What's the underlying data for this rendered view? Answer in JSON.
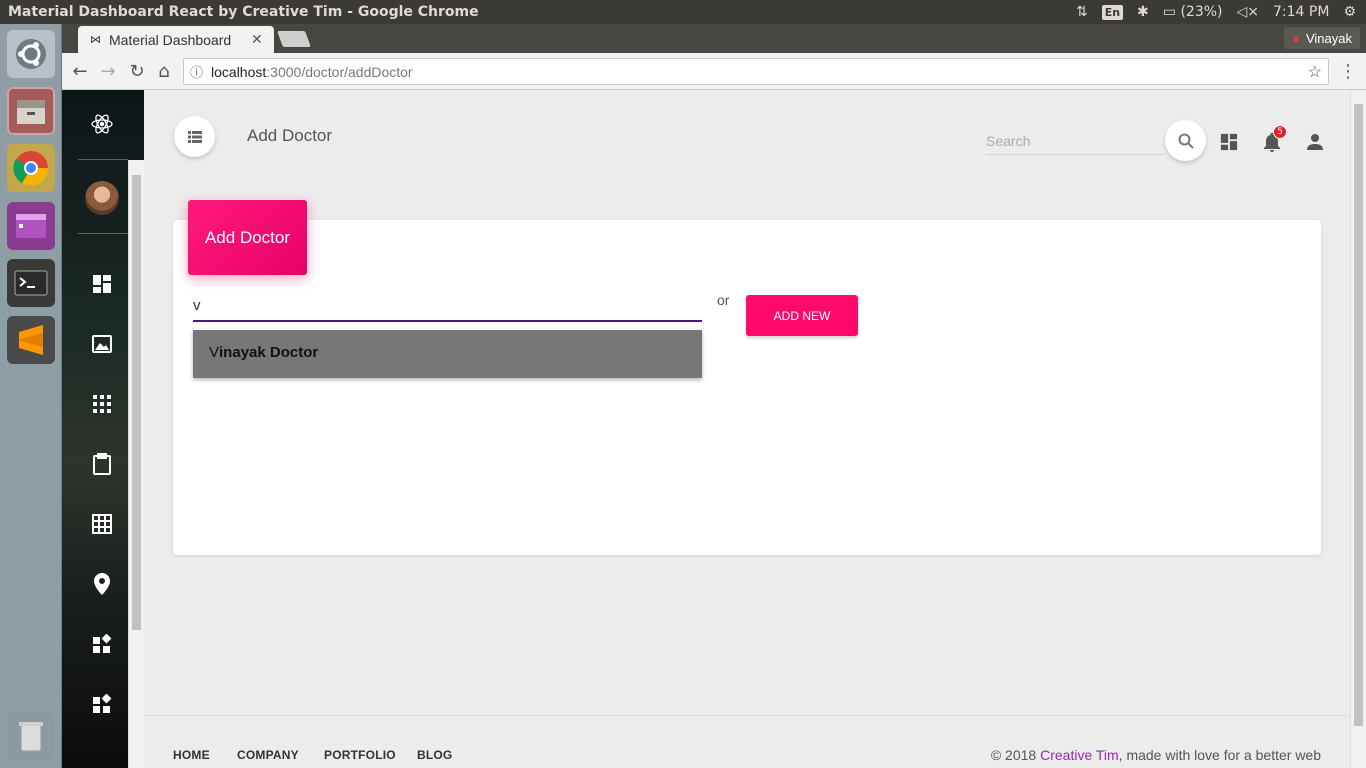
{
  "os": {
    "window_title": "Material Dashboard React by Creative Tim - Google Chrome",
    "lang": "En",
    "battery": "(23%)",
    "time": "7:14 PM"
  },
  "browser": {
    "tab_title": "Material Dashboard",
    "profile_name": "Vinayak",
    "url_host": "localhost",
    "url_path": ":3000/doctor/addDoctor"
  },
  "header": {
    "title": "Add Doctor",
    "search_placeholder": "Search",
    "notification_count": "5"
  },
  "card": {
    "title": "Add Doctor",
    "input_value": "v",
    "or_label": "or",
    "add_new_label": "ADD NEW",
    "suggestion_match": "V",
    "suggestion_rest": "inayak Doctor"
  },
  "footer": {
    "links": [
      "HOME",
      "COMPANY",
      "PORTFOLIO",
      "BLOG"
    ],
    "copyright_prefix": "© 2018 ",
    "copyright_brand": "Creative Tim",
    "copyright_suffix": ", made with love for a better web"
  },
  "colors": {
    "accent": "#ff0a6c",
    "input_underline": "#4a148c",
    "brand_link": "#9c27b0"
  }
}
